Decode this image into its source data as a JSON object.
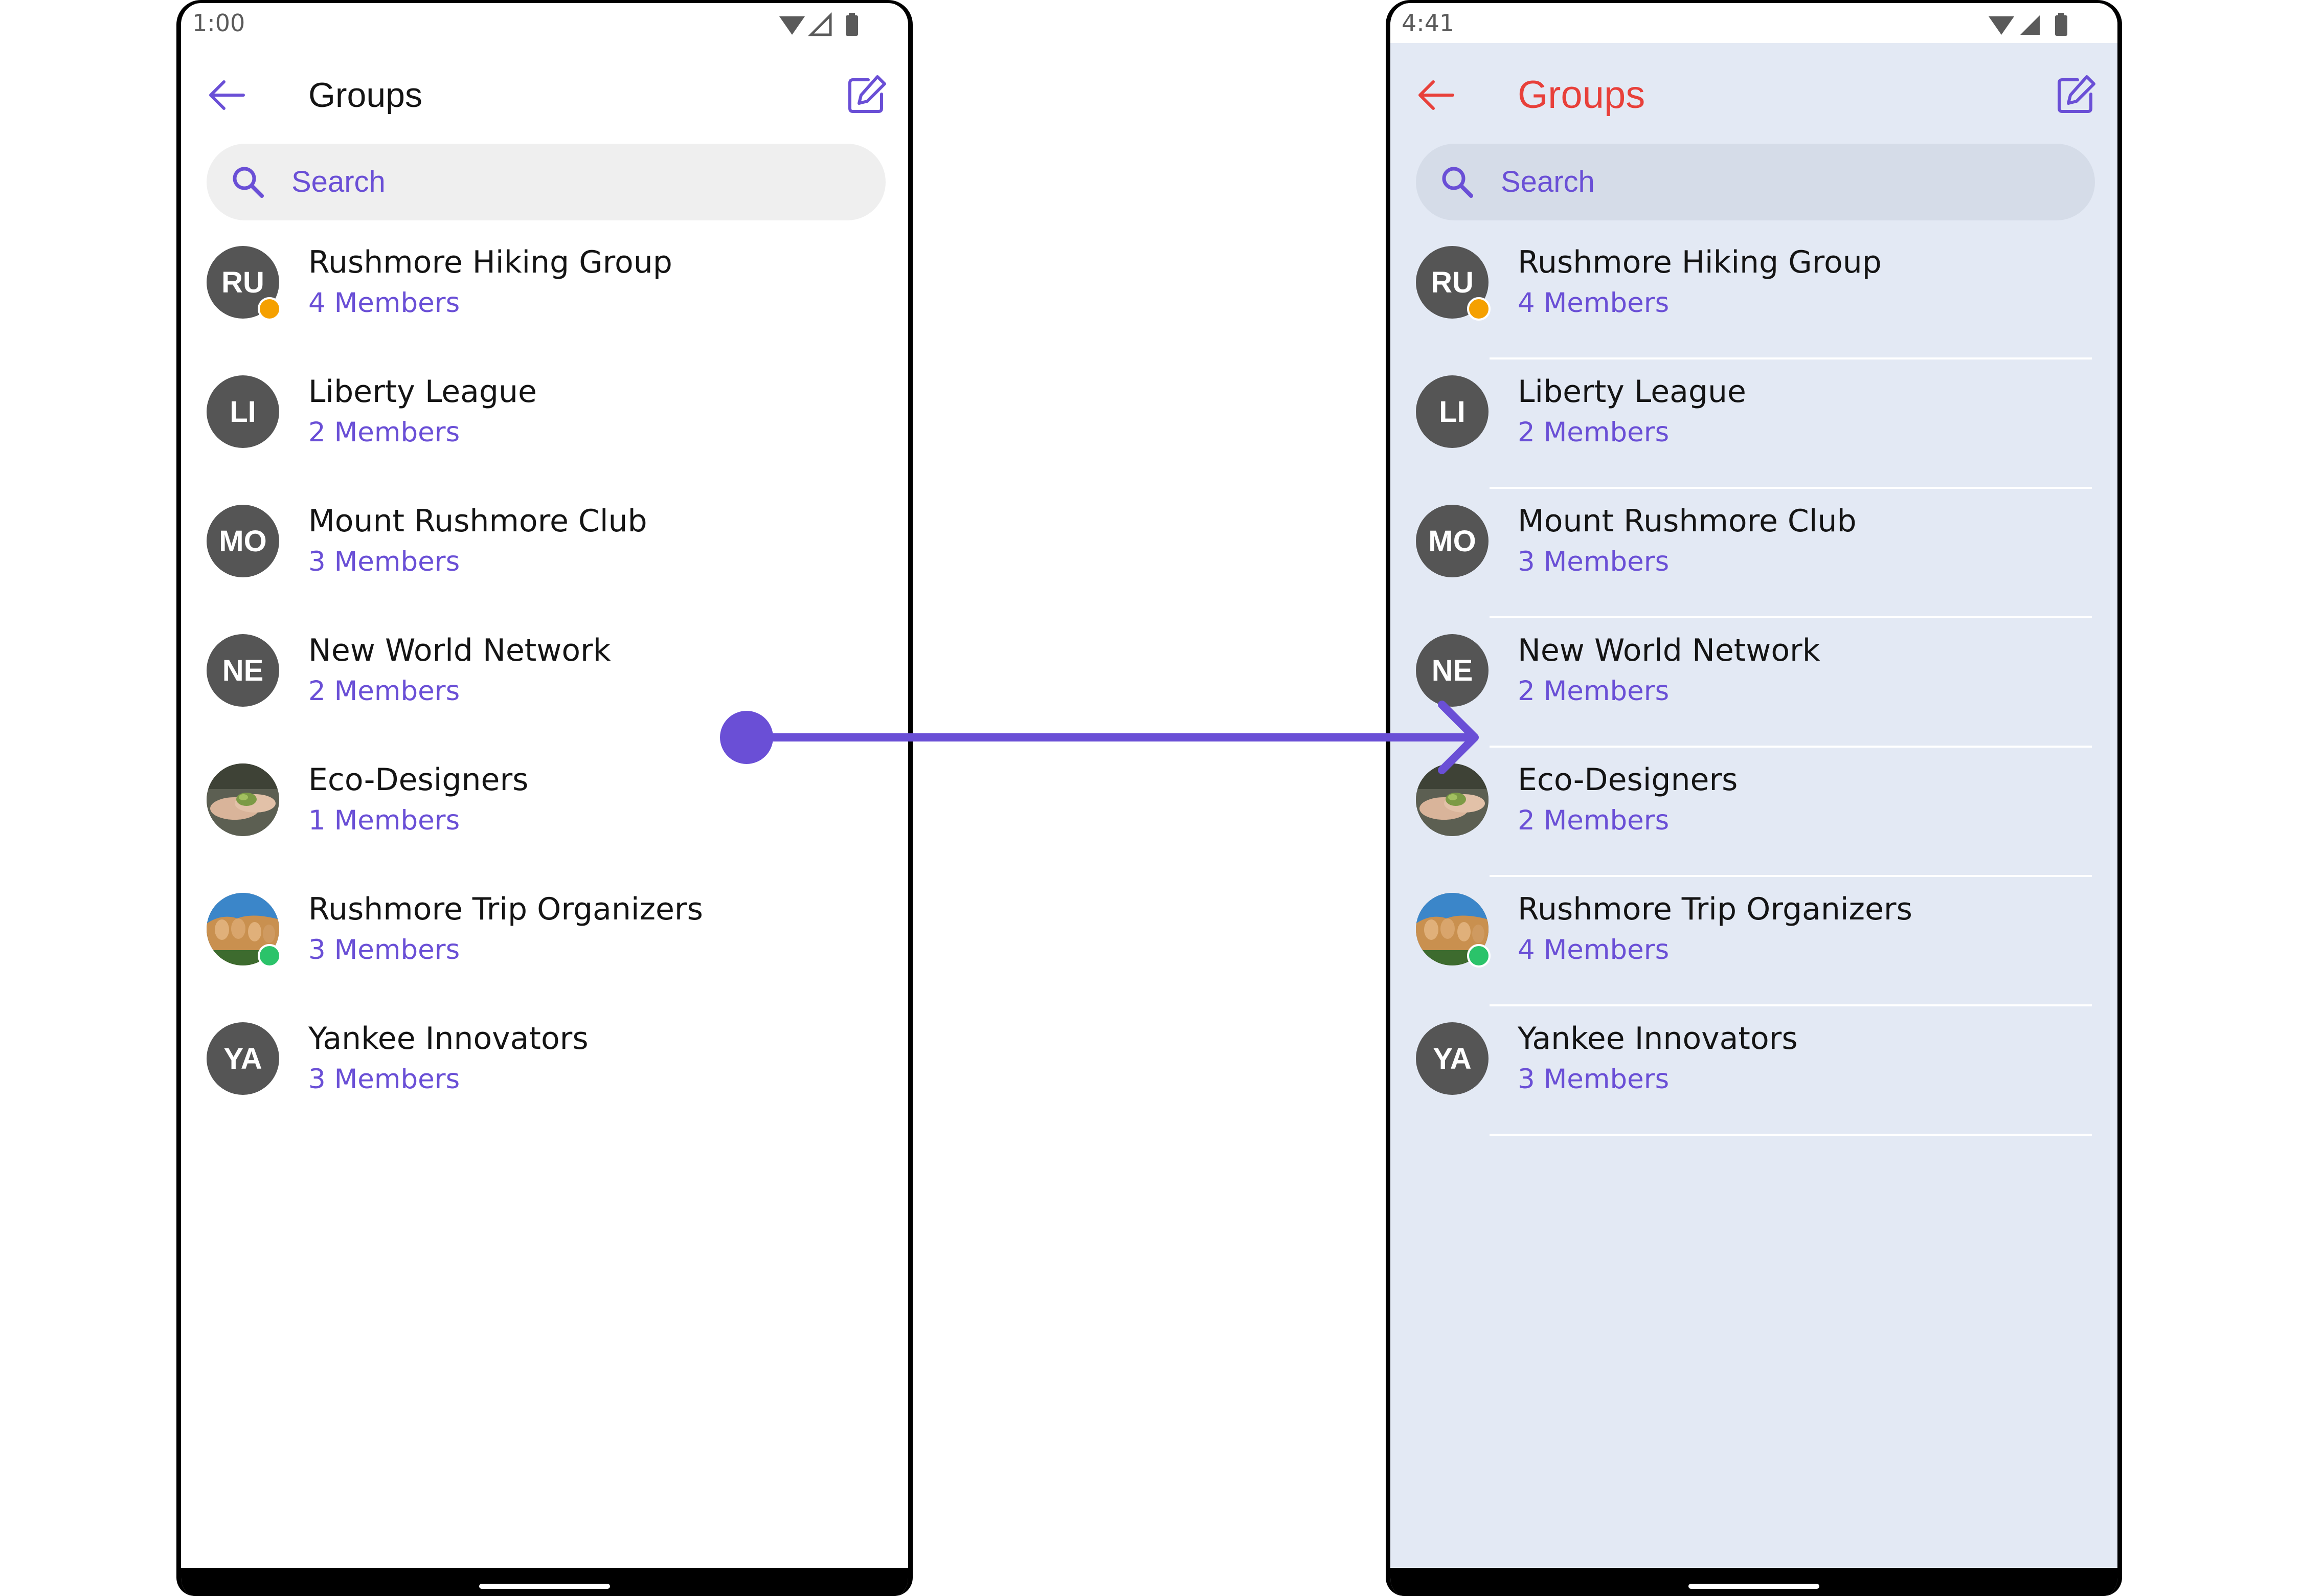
{
  "colors": {
    "accent": "#6a4fd6",
    "title_highlight": "#e8403a",
    "right_background": "#e3e9f4",
    "avatar": "#555555",
    "private_badge": "#f5a000",
    "password_badge": "#2bc36a"
  },
  "left": {
    "status": {
      "time": "1:00"
    },
    "header": {
      "title": "Groups",
      "back_icon": "arrow-left-icon",
      "compose_icon": "edit-icon"
    },
    "search": {
      "placeholder": "Search",
      "icon": "search-icon"
    },
    "groups": [
      {
        "initials": "RU",
        "name": "Rushmore Hiking Group",
        "members": "4 Members",
        "badge": "private"
      },
      {
        "initials": "LI",
        "name": "Liberty League",
        "members": "2 Members"
      },
      {
        "initials": "MO",
        "name": "Mount Rushmore Club",
        "members": "3 Members"
      },
      {
        "initials": "NE",
        "name": "New World Network",
        "members": "2 Members"
      },
      {
        "initials": "",
        "name": "Eco-Designers",
        "members": "1 Members",
        "image": "hands-plant-photo"
      },
      {
        "initials": "",
        "name": "Rushmore Trip Organizers",
        "members": "3 Members",
        "image": "mount-rushmore-photo",
        "badge": "password"
      },
      {
        "initials": "YA",
        "name": "Yankee Innovators",
        "members": "3 Members"
      }
    ]
  },
  "right": {
    "status": {
      "time": "4:41"
    },
    "header": {
      "title": "Groups",
      "back_icon": "arrow-left-icon",
      "compose_icon": "edit-icon"
    },
    "search": {
      "placeholder": "Search",
      "icon": "search-icon"
    },
    "groups": [
      {
        "initials": "RU",
        "name": "Rushmore Hiking Group",
        "members": "4 Members",
        "badge": "private"
      },
      {
        "initials": "LI",
        "name": "Liberty League",
        "members": "2 Members"
      },
      {
        "initials": "MO",
        "name": "Mount Rushmore Club",
        "members": "3 Members"
      },
      {
        "initials": "NE",
        "name": "New World Network",
        "members": "2 Members"
      },
      {
        "initials": "",
        "name": "Eco-Designers",
        "members": "2 Members",
        "image": "hands-plant-photo"
      },
      {
        "initials": "",
        "name": "Rushmore Trip Organizers",
        "members": "4 Members",
        "image": "mount-rushmore-photo",
        "badge": "password"
      },
      {
        "initials": "YA",
        "name": "Yankee Innovators",
        "members": "3 Members"
      }
    ]
  }
}
